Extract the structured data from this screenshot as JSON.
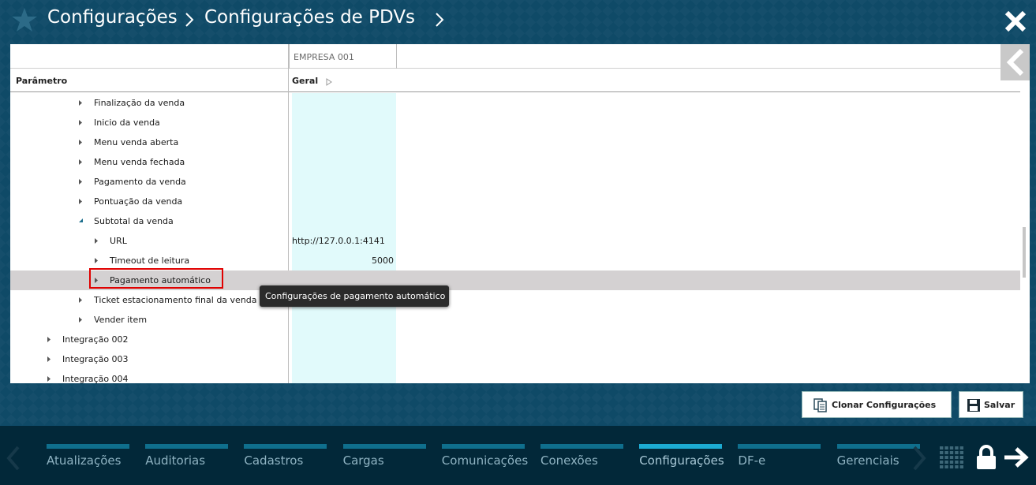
{
  "header": {
    "breadcrumb": [
      "Configurações",
      "Configurações de PDVs"
    ]
  },
  "grid": {
    "company_column": "EMPRESA 001",
    "param_header": "Parâmetro",
    "geral_header": "Geral"
  },
  "tree": [
    {
      "label": "Finalização da venda",
      "level": 2,
      "expanded": false,
      "value": ""
    },
    {
      "label": "Inicio da venda",
      "level": 2,
      "expanded": false,
      "value": ""
    },
    {
      "label": "Menu venda aberta",
      "level": 2,
      "expanded": false,
      "value": ""
    },
    {
      "label": "Menu venda fechada",
      "level": 2,
      "expanded": false,
      "value": ""
    },
    {
      "label": "Pagamento da venda",
      "level": 2,
      "expanded": false,
      "value": ""
    },
    {
      "label": "Pontuação da venda",
      "level": 2,
      "expanded": false,
      "value": ""
    },
    {
      "label": "Subtotal da venda",
      "level": 2,
      "expanded": true,
      "value": ""
    },
    {
      "label": "URL",
      "level": 3,
      "expanded": false,
      "value": "http://127.0.0.1:4141"
    },
    {
      "label": "Timeout de leitura",
      "level": 3,
      "expanded": false,
      "value": "5000"
    },
    {
      "label": "Pagamento automático",
      "level": 3,
      "expanded": false,
      "value": "",
      "selected": true
    },
    {
      "label": "Ticket estacionamento final da venda",
      "level": 2,
      "expanded": false,
      "value": ""
    },
    {
      "label": "Vender item",
      "level": 2,
      "expanded": false,
      "value": ""
    },
    {
      "label": "Integração 002",
      "level": 1,
      "expanded": false,
      "value": ""
    },
    {
      "label": "Integração 003",
      "level": 1,
      "expanded": false,
      "value": ""
    },
    {
      "label": "Integração 004",
      "level": 1,
      "expanded": false,
      "value": ""
    }
  ],
  "tooltip": "Configurações de pagamento automático",
  "actions": {
    "clone_label": "Clonar Configurações",
    "save_label": "Salvar"
  },
  "bottom_nav": {
    "items": [
      {
        "label": "Atualizações",
        "active": false
      },
      {
        "label": "Auditorias",
        "active": false
      },
      {
        "label": "Cadastros",
        "active": false
      },
      {
        "label": "Cargas",
        "active": false
      },
      {
        "label": "Comunicações",
        "active": false
      },
      {
        "label": "Conexões",
        "active": false
      },
      {
        "label": "Configurações",
        "active": true
      },
      {
        "label": "DF-e",
        "active": false
      },
      {
        "label": "Gerenciais",
        "active": false
      }
    ]
  },
  "colors": {
    "background": "#0f4a67",
    "geral_column": "#e1fafb",
    "selected_row": "#d4d1d2",
    "highlight_border": "#e00000",
    "nav_active": "#1cabd2",
    "nav_inactive": "#0f6f8d"
  },
  "icons": [
    "star-icon",
    "chevron-right-icon",
    "close-icon",
    "collapse-left-icon",
    "caret-right-icon",
    "caret-down-icon",
    "clone-icon",
    "save-icon",
    "grid-icon",
    "lock-icon",
    "logout-icon"
  ]
}
